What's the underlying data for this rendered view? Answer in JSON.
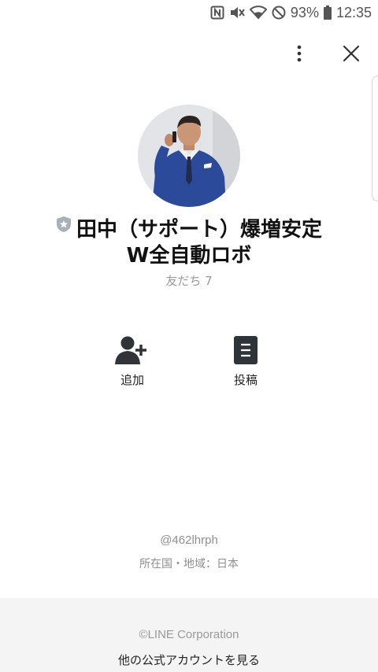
{
  "status_bar": {
    "battery_percent": "93%",
    "time": "12:35",
    "icons": [
      "nfc-icon",
      "mute-icon",
      "wifi-icon",
      "do-not-disturb-icon",
      "battery-icon"
    ]
  },
  "header": {
    "menu_icon": "more-vertical-icon",
    "close_icon": "close-icon"
  },
  "profile": {
    "badge_icon": "official-account-shield-icon",
    "name": "田中（サポート）爆増安定W全自動ロボ",
    "friends_count": "友だち 7"
  },
  "actions": [
    {
      "label": "追加",
      "icon": "add-friend-icon"
    },
    {
      "label": "投稿",
      "icon": "posts-icon"
    }
  ],
  "info": {
    "account_id": "@462lhrph",
    "region": "所在国・地域：日本"
  },
  "footer": {
    "copyright": "©LINE Corporation",
    "other_accounts_link": "他の公式アカウントを見る"
  },
  "colors": {
    "badge_gray": "#aab0b8",
    "icon_dark": "#2f3439",
    "footer_bg": "#f4f4f4"
  }
}
